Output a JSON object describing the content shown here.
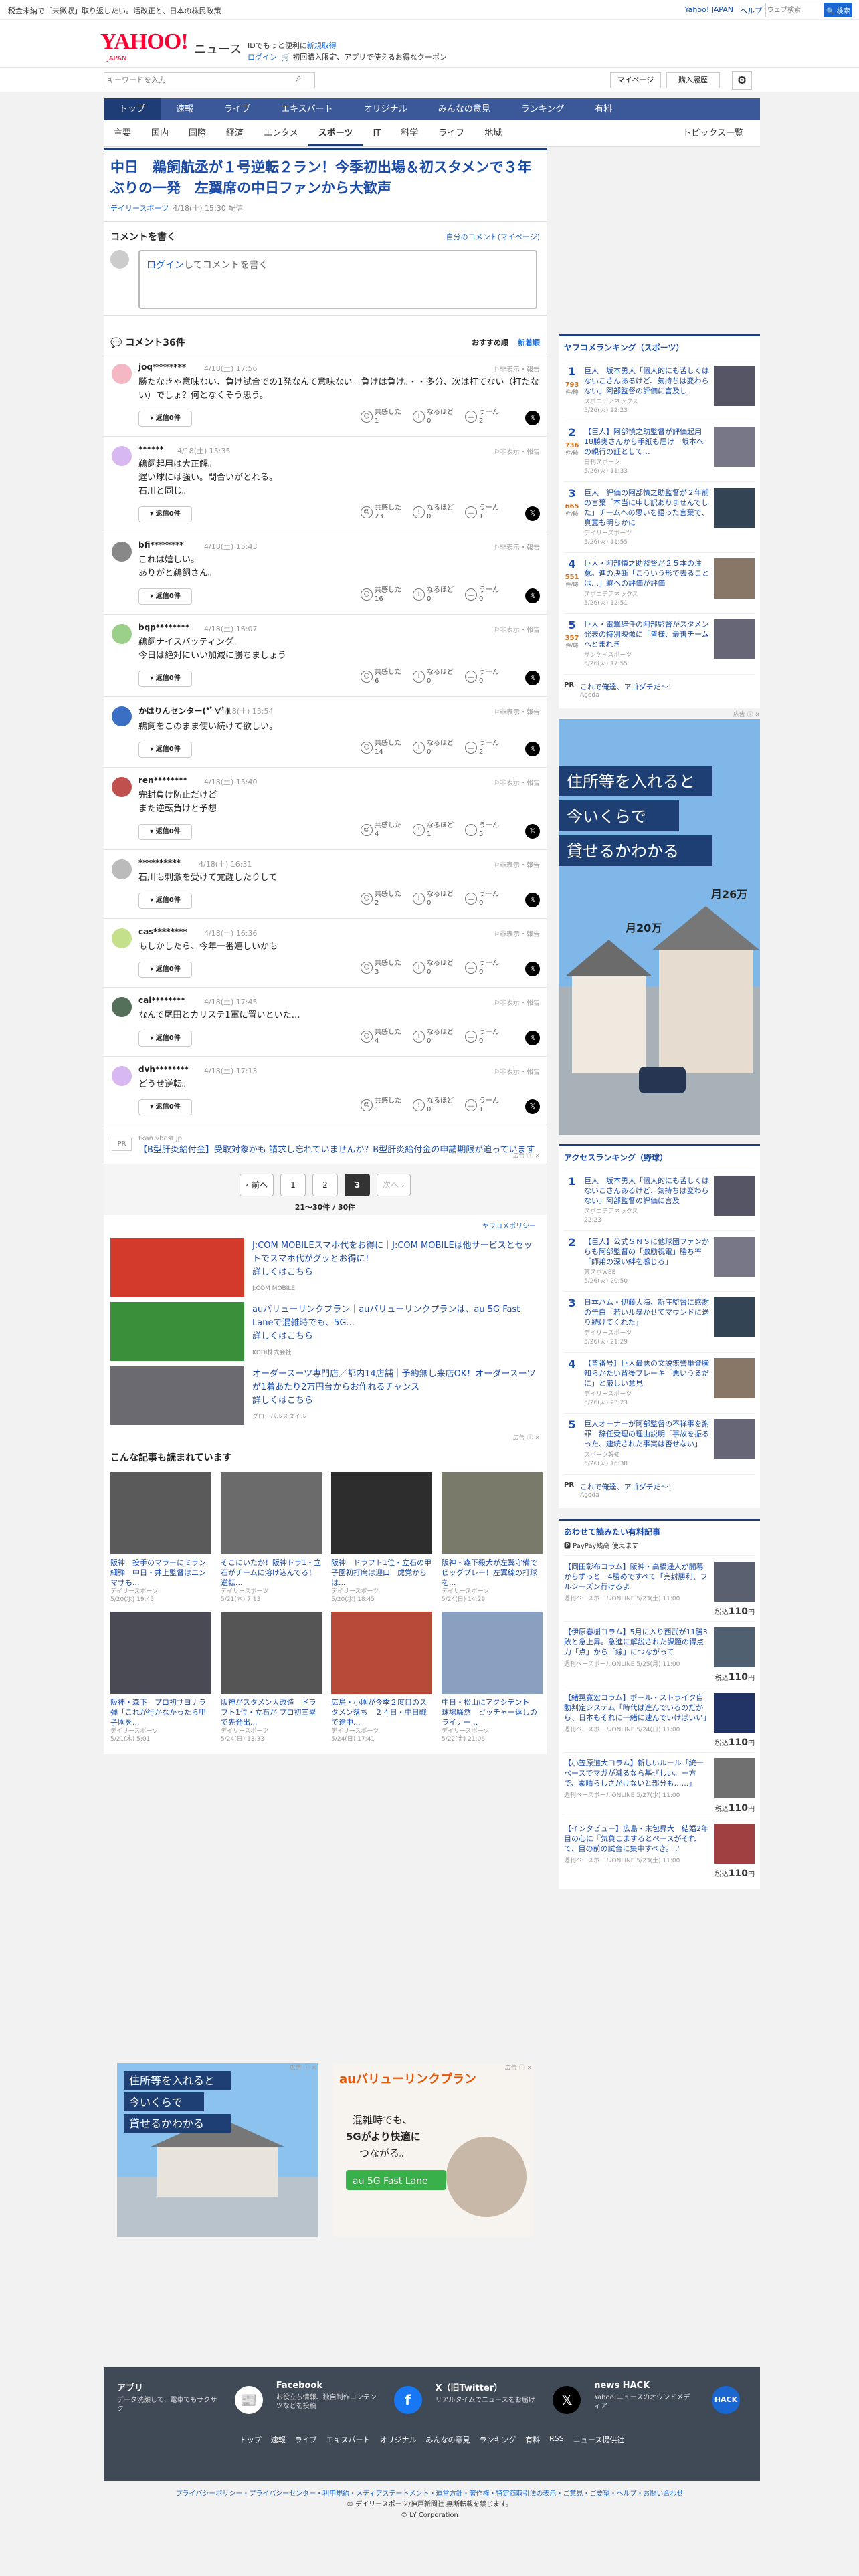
{
  "top": {
    "tax_pre": "税金未納で「",
    "tax_hl": "未納",
    "tax_text": "税金未納で「未徴収」取り返したい。活改正と、日本の株民政策",
    "links": [
      "Yahoo! JAPAN",
      "ヘルプ"
    ],
    "search_placeholder": "ウェブ検索",
    "search_btn": "🔍 検索"
  },
  "header": {
    "logo": "YAHOO!",
    "logo_sub": "JAPAN",
    "news": "ニュース",
    "promo1_pre": "IDでもっと便利に",
    "promo1_link": "新規取得",
    "promo2_link": "ログイン",
    "promo2_text": "🛒 初回購入限定、アプリで使えるお得なクーポン"
  },
  "search": {
    "placeholder": "キーワードを入力",
    "mypage": "マイページ",
    "history": "購入履歴"
  },
  "gnav": [
    "トップ",
    "速報",
    "ライブ",
    "エキスパート",
    "オリジナル",
    "みんなの意見",
    "ランキング",
    "有料"
  ],
  "subnav": [
    "主要",
    "国内",
    "国際",
    "経済",
    "エンタメ",
    "スポーツ",
    "IT",
    "科学",
    "ライフ",
    "地域"
  ],
  "subnav_right": "トピックス一覧",
  "article": {
    "title": "中日　鵜飼航丞が１号逆転２ラン！今季初出場＆初スタメンで３年ぶりの一発　左翼席の中日ファンから大歓声",
    "source": "デイリースポーツ",
    "date": "4/18(土) 15:30 配信"
  },
  "write": {
    "heading": "コメントを書く",
    "mine": "自分のコメント(マイページ)",
    "login": "ログイン",
    "placeholder": "してコメントを書く"
  },
  "comments_head": {
    "title": "コメント36件",
    "sort1": "おすすめ順",
    "sort2": "新着順"
  },
  "labels": {
    "report": "⚐非表示・報告",
    "reply": "▾ 返信0件",
    "empathy": "共感した",
    "nodoku": "なるほど",
    "uun": "うーん",
    "x": "𝕏"
  },
  "comments": [
    {
      "author": "joq********",
      "date": "4/18(土) 17:56",
      "text": "勝たなきゃ意味ない、負け試合での1発なんて意味ない。負けは負け。・・多分、次は打てない（打たない）でしょ？何となくそう思う。",
      "e": "1",
      "n": "0",
      "u": "2",
      "color": "#f4b8c4"
    },
    {
      "author": "******",
      "date": "4/18(土) 15:35",
      "text": "鵜飼起用は大正解。\n遅い球には強い。間合いがとれる。\n石川と同じ。",
      "e": "23",
      "n": "0",
      "u": "1",
      "color": "#d8b8f0"
    },
    {
      "author": "bfi********",
      "date": "4/18(土) 15:43",
      "text": "これは嬉しい。\nありがと鵜飼さん。",
      "e": "16",
      "n": "0",
      "u": "0",
      "color": "#888"
    },
    {
      "author": "bqp********",
      "date": "4/18(土) 16:07",
      "text": "鵜飼ナイスバッティング。\n今日は絶対にいい加減に勝ちましょう",
      "e": "6",
      "n": "0",
      "u": "0",
      "color": "#9ad08a"
    },
    {
      "author": "かはりんセンター(*ﾟ∀ﾟ)",
      "date": "4/18(土) 15:54",
      "text": "鵜飼をこのまま使い続けて欲しい。",
      "e": "14",
      "n": "0",
      "u": "2",
      "color": "#3b6fc4"
    },
    {
      "author": "ren********",
      "date": "4/18(土) 15:40",
      "text": "完封負け防止だけど\nまた逆転負けと予想",
      "e": "4",
      "n": "1",
      "u": "5",
      "color": "#c0504d"
    },
    {
      "author": "**********",
      "date": "4/18(土) 16:31",
      "text": "石川も刺激を受けて覚醒したりして",
      "e": "2",
      "n": "0",
      "u": "0",
      "color": "#bbb"
    },
    {
      "author": "cas********",
      "date": "4/18(土) 16:36",
      "text": "もしかしたら、今年一番嬉しいかも",
      "e": "3",
      "n": "0",
      "u": "0",
      "color": "#c5e08a"
    },
    {
      "author": "cal********",
      "date": "4/18(土) 17:45",
      "text": "なんで尾田とカリステ1軍に置いといた…",
      "e": "4",
      "n": "0",
      "u": "0",
      "color": "#55705a"
    },
    {
      "author": "dvh********",
      "date": "4/18(土) 17:13",
      "text": "どうせ逆転。",
      "e": "1",
      "n": "0",
      "u": "1",
      "color": "#d8b8f0"
    }
  ],
  "pr_item": {
    "badge": "PR",
    "domain": "tkan.vbest.jp",
    "text": "【B型肝炎給付金】受取対象かも 請求し忘れていませんか？B型肝炎給付金の申請期限が迫っています",
    "ad": "広告 ⓘ ✕"
  },
  "pager": {
    "prev": "‹ 前へ",
    "p1": "1",
    "p2": "2",
    "p3": "3",
    "next": "次へ ›",
    "count": "21〜30件 / 30件"
  },
  "policy": "ヤフコメポリシー",
  "ads": [
    {
      "title": "J:COM MOBILEスマホ代をお得に｜J:COM MOBILEは他サービスとセットでスマホ代がグッとお得に！",
      "more": "詳しくはこちら",
      "src": "J:COM MOBILE",
      "img": "#d43a2c"
    },
    {
      "title": "auバリューリンクプラン｜auバリューリンクプランは、au 5G Fast Laneで混雑時でも、5G...",
      "more": "詳しくはこちら",
      "src": "KDDI株式会社",
      "img": "#3a8f3a"
    },
    {
      "title": "オーダースーツ専門店／都内14店舗｜予約無し来店OK！オーダースーツが1着あたり2万円台からお作れるチャンス",
      "more": "詳しくはこちら",
      "src": "グローバルスタイル",
      "img": "#6a6a70"
    }
  ],
  "ad_label": "広告 ⓘ ✕",
  "also": {
    "title": "こんな記事も読まれています",
    "items": [
      {
        "t": "阪神　投手のマラーにミラン細弾　中日・井上監督はエンマサも...",
        "s": "デイリースポーツ",
        "d": "5/20(水) 19:45",
        "c": "#5a5a5a"
      },
      {
        "t": "そこにいたか！阪神ドラ1・立石がチームに溶け込んでる！逆転...",
        "s": "デイリースポーツ",
        "d": "5/21(木) 7:13",
        "c": "#6b6b6b"
      },
      {
        "t": "阪神　ドラフト1位・立石の甲子園初打席は迎口　虎党からは...",
        "s": "デイリースポーツ",
        "d": "5/20(水) 18:45",
        "c": "#2d2d2d"
      },
      {
        "t": "阪神・森下殺犬が左翼守備でビッグプレー！左翼線の打球を...",
        "s": "デイリースポーツ",
        "d": "5/24(日) 14:29",
        "c": "#7a7a6a"
      },
      {
        "t": "阪神・森下　プロ初サヨナラ弾「これが行かなかったら甲子園を...",
        "s": "デイリースポーツ",
        "d": "5/21(木) 5:01",
        "c": "#4a4a55"
      },
      {
        "t": "阪神がスタメン大改造　ドラフト1位・立石が プロ初三塁で先発出...",
        "s": "デイリースポーツ",
        "d": "5/24(日) 13:33",
        "c": "#555555"
      },
      {
        "t": "広島・小園が今季２度目のスタメン落ち　２４日・中日戦で途中...",
        "s": "デイリースポーツ",
        "d": "5/24(日) 17:41",
        "c": "#b84a3a"
      },
      {
        "t": "中日・松山にアクシデント　球場騒然　ピッチャー返しのライナー...",
        "s": "デイリースポーツ",
        "d": "5/22(金) 21:06",
        "c": "#8aa0c0"
      }
    ]
  },
  "rank_sports": {
    "title": "ヤフコメランキング（スポーツ）",
    "items": [
      {
        "n": "1",
        "v": "793",
        "u": "件/時",
        "t": "巨人　坂本勇人「個人的にも苦しくはないこさんあるけど、気持ちは変わらない」阿部監督の評価に言及し",
        "s": "スポニチアネックス",
        "d": "5/26(火) 22:23"
      },
      {
        "n": "2",
        "v": "736",
        "u": "件/時",
        "t": "【巨人】阿部慎之助監督が評価起用　18勝奥さんから手紙も届け　坂本への親行の証として…",
        "s": "日刊スポーツ",
        "d": "5/26(火) 11:33"
      },
      {
        "n": "3",
        "v": "665",
        "u": "件/時",
        "t": "巨人　評価の阿部慎之助監督が２年前の言葉「本当に申し訳ありませんでした」チームへの思いを語った言葉で、真意も明らかに",
        "s": "デイリースポーツ",
        "d": "5/26(火) 11:55"
      },
      {
        "n": "4",
        "v": "551",
        "u": "件/時",
        "t": "巨人・阿部慎之助監督が２５本の注意。進の決断「こういう形で去ることは…」継への評価が評価",
        "s": "スポニチアネックス",
        "d": "5/26(火) 12:51"
      },
      {
        "n": "5",
        "v": "357",
        "u": "件/時",
        "t": "巨人・電撃辞任の阿部監督がスタメン発表の特別映像に「皆様、最善チームへとまれき",
        "s": "サンケイスポーツ",
        "d": "5/26(火) 17:55"
      }
    ],
    "pr": {
      "b": "PR",
      "t": "これで俺達、アゴダチだ～！",
      "s": "Agoda"
    }
  },
  "side_ad": {
    "l1": "住所等を入れると",
    "l2": "今いくらで",
    "l3": "貸せるかわかる",
    "price1": "月20万",
    "price2": "月26万",
    "label": "広告 ⓘ ✕"
  },
  "rank_access": {
    "title": "アクセスランキング（野球）",
    "items": [
      {
        "n": "1",
        "t": "巨人　坂本勇人「個人的にも苦しくはないこさんあるけど、気持ちは変わらない」阿部監督の評価に言及",
        "s": "スポニチアネックス",
        "d": "22:23"
      },
      {
        "n": "2",
        "t": "【巨人】公式ＳＮＳに他球団ファンからも阿部監督の「激励祝電」勝ち率「師弟の深い絆を感じる」",
        "s": "東スポWEB",
        "d": "5/26(火) 20:50"
      },
      {
        "n": "3",
        "t": "日本ハム・伊藤大海、新庄監督に感謝の告白「若いル暴かせてマウンドに送り続けてくれた」",
        "s": "デイリースポーツ",
        "d": "5/26(火) 21:29"
      },
      {
        "n": "4",
        "t": "【背番号】巨人最悪の文説無誉単登騰　知らかたい背後ブレーキ「悪いうるだに」と厳しい意見",
        "s": "デイリースポーツ",
        "d": "5/26(火) 23:23"
      },
      {
        "n": "5",
        "t": "巨人オーナーが阿部監督の不祥事を謝罪　辞任受理の理由説明「事故を振るった、連続された事実は否せない」",
        "s": "スポーツ報知",
        "d": "5/26(火) 16:38"
      }
    ],
    "pr": {
      "b": "PR",
      "t": "これで俺達、アゴダチだ～！",
      "s": "Agoda"
    }
  },
  "mag": {
    "title": "あわせて読みたい有料記事",
    "pp": "🅿 PayPay残高 使えます",
    "items": [
      {
        "t": "【岡田彰布コラム】阪神・高橋遥人が開幕からずっと　4勝めですべて「完封勝利、フルシーズン行けるよ",
        "s": "週刊ベースボールONLINE 5/23(土) 11:00",
        "p": "110",
        "c": "#5a6070"
      },
      {
        "t": "【伊原春樹コラム】5月に入り西武が11勝3敗と急上昇。急進に解説された課題の得点力「点」から「線」につながって",
        "s": "週刊ベースボールONLINE 5/25(月) 11:00",
        "p": "110",
        "c": "#506070"
      },
      {
        "t": "【緒晃寛宏コラム】ボール・ストライク自動判定システム「時代は進んでいるのだから、日本もそれに一緒に速んでいけばいい」",
        "s": "週刊ベースボールONLINE 5/24(日) 11:00",
        "p": "110",
        "c": "#223366"
      },
      {
        "t": "【小笠原道大コラム】新しいルール「統一ベースでマガが減るなら基ぜしい。一方で、素晴らしさがけないと部分も……」",
        "s": "週刊ベースボールONLINE 5/27(水) 11:00",
        "p": "110",
        "c": "#707070"
      },
      {
        "t": "【インタビュー】広島・末包昇大　結婚2年目の心に『気負こまするとペースがそれて、目の前の試合に集中すべき。','",
        "s": "週刊ベースボールONLINE 5/23(土) 11:00",
        "p": "110",
        "c": "#a04040"
      }
    ],
    "price_pre": "税込",
    "price_post": "円"
  },
  "bottom_ads": [
    {
      "l1": "住所等を入れると",
      "l2": "今いくらで",
      "l3": "貸せるかわかる",
      "label": "広告 ⓘ ✕"
    },
    {
      "l1": "混雑時でも、",
      "l2": "5Gがより快適に",
      "l3": "つながる。",
      "brand": "auバリューリンクプラン",
      "sub": "au 5G Fast Lane",
      "label": "広告 ⓘ ✕"
    }
  ],
  "footer": {
    "apps": [
      {
        "h": "アプリ",
        "d": "データ洗顔して、電車でもサクサク",
        "ic": "📰",
        "bg": "#fff",
        "fg": "#ff0033"
      },
      {
        "h": "Facebook",
        "d": "お役立ち情報、独自制作コンテンツなどを投稿",
        "ic": "f",
        "bg": "#1877f2",
        "fg": "#fff"
      },
      {
        "h": "X（旧Twitter）",
        "d": "リアルタイムでニュースをお届け",
        "ic": "𝕏",
        "bg": "#000",
        "fg": "#fff"
      },
      {
        "h": "news HACK",
        "d": "Yahoo!ニュースのオウンドメディア",
        "ic": "HACK",
        "bg": "#1a67d2",
        "fg": "#fff"
      }
    ],
    "links": [
      "トップ",
      "速報",
      "ライブ",
      "エキスパート",
      "オリジナル",
      "みんなの意見",
      "ランキング",
      "有料",
      "RSS",
      "ニュース提供社"
    ]
  },
  "copyright": {
    "links": "プライバシーポリシー・プライバシーセンター・利用規約・メディアステートメント・運営方針・著作権・特定商取引法の表示・ご意見・ご要望・ヘルプ・お問い合わせ",
    "line2": "© デイリースポーツ/神戸新聞社 無断転載を禁じます。",
    "line3": "© LY Corporation"
  }
}
